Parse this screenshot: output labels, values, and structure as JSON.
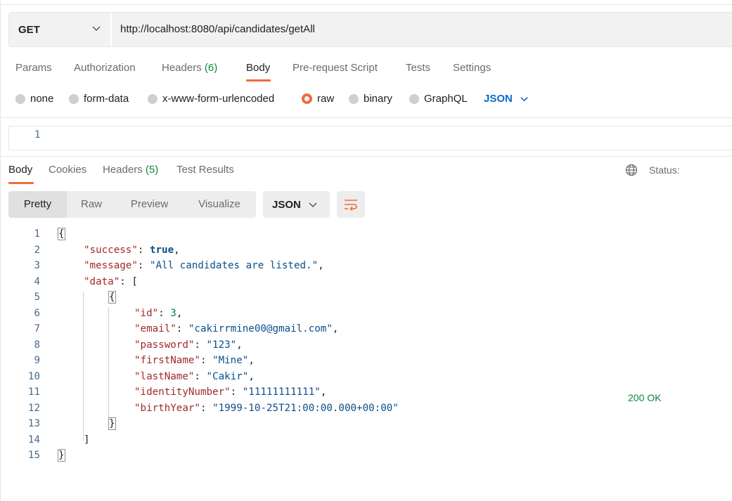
{
  "request": {
    "method": "GET",
    "url": "http://localhost:8080/api/candidates/getAll"
  },
  "request_tabs": [
    {
      "label": "Params"
    },
    {
      "label": "Authorization"
    },
    {
      "label": "Headers",
      "count": "(6)"
    },
    {
      "label": "Body",
      "active": true
    },
    {
      "label": "Pre-request Script"
    },
    {
      "label": "Tests"
    },
    {
      "label": "Settings"
    }
  ],
  "body_types": [
    {
      "label": "none"
    },
    {
      "label": "form-data"
    },
    {
      "label": "x-www-form-urlencoded"
    },
    {
      "label": "raw",
      "selected": true
    },
    {
      "label": "binary"
    },
    {
      "label": "GraphQL"
    }
  ],
  "body_format": "JSON",
  "request_editor": {
    "line_number": "1"
  },
  "response_tabs": [
    {
      "label": "Body",
      "active": true
    },
    {
      "label": "Cookies"
    },
    {
      "label": "Headers",
      "count": "(5)"
    },
    {
      "label": "Test Results"
    }
  ],
  "status": {
    "label": "Status:",
    "code": "200 OK"
  },
  "view_modes": [
    {
      "label": "Pretty",
      "active": true
    },
    {
      "label": "Raw"
    },
    {
      "label": "Preview"
    },
    {
      "label": "Visualize"
    }
  ],
  "response_format": "JSON",
  "response_lines": [
    {
      "n": "1",
      "indent": 0,
      "tokens": [
        {
          "t": "{",
          "c": "p",
          "box": true
        }
      ]
    },
    {
      "n": "2",
      "indent": 1,
      "tokens": [
        {
          "t": "\"success\"",
          "c": "k"
        },
        {
          "t": ": ",
          "c": "p"
        },
        {
          "t": "true",
          "c": "b"
        },
        {
          "t": ",",
          "c": "p"
        }
      ]
    },
    {
      "n": "3",
      "indent": 1,
      "tokens": [
        {
          "t": "\"message\"",
          "c": "k"
        },
        {
          "t": ": ",
          "c": "p"
        },
        {
          "t": "\"All candidates are listed.\"",
          "c": "s"
        },
        {
          "t": ",",
          "c": "p"
        }
      ]
    },
    {
      "n": "4",
      "indent": 1,
      "tokens": [
        {
          "t": "\"data\"",
          "c": "k"
        },
        {
          "t": ": [",
          "c": "p"
        }
      ]
    },
    {
      "n": "5",
      "indent": 2,
      "tokens": [
        {
          "t": "{",
          "c": "p",
          "box": true
        }
      ]
    },
    {
      "n": "6",
      "indent": 3,
      "tokens": [
        {
          "t": "\"id\"",
          "c": "k"
        },
        {
          "t": ": ",
          "c": "p"
        },
        {
          "t": "3",
          "c": "n"
        },
        {
          "t": ",",
          "c": "p"
        }
      ]
    },
    {
      "n": "7",
      "indent": 3,
      "tokens": [
        {
          "t": "\"email\"",
          "c": "k"
        },
        {
          "t": ": ",
          "c": "p"
        },
        {
          "t": "\"cakirrmine00@gmail.com\"",
          "c": "s"
        },
        {
          "t": ",",
          "c": "p"
        }
      ]
    },
    {
      "n": "8",
      "indent": 3,
      "tokens": [
        {
          "t": "\"password\"",
          "c": "k"
        },
        {
          "t": ": ",
          "c": "p"
        },
        {
          "t": "\"123\"",
          "c": "s"
        },
        {
          "t": ",",
          "c": "p"
        }
      ]
    },
    {
      "n": "9",
      "indent": 3,
      "tokens": [
        {
          "t": "\"firstName\"",
          "c": "k"
        },
        {
          "t": ": ",
          "c": "p"
        },
        {
          "t": "\"Mine\"",
          "c": "s"
        },
        {
          "t": ",",
          "c": "p"
        }
      ]
    },
    {
      "n": "10",
      "indent": 3,
      "tokens": [
        {
          "t": "\"lastName\"",
          "c": "k"
        },
        {
          "t": ": ",
          "c": "p"
        },
        {
          "t": "\"Cakir\"",
          "c": "s"
        },
        {
          "t": ",",
          "c": "p"
        }
      ]
    },
    {
      "n": "11",
      "indent": 3,
      "tokens": [
        {
          "t": "\"identityNumber\"",
          "c": "k"
        },
        {
          "t": ": ",
          "c": "p"
        },
        {
          "t": "\"11111111111\"",
          "c": "s"
        },
        {
          "t": ",",
          "c": "p"
        }
      ]
    },
    {
      "n": "12",
      "indent": 3,
      "tokens": [
        {
          "t": "\"birthYear\"",
          "c": "k"
        },
        {
          "t": ": ",
          "c": "p"
        },
        {
          "t": "\"1999-10-25T21:00:00.000+00:00\"",
          "c": "s"
        }
      ]
    },
    {
      "n": "13",
      "indent": 2,
      "tokens": [
        {
          "t": "}",
          "c": "p",
          "box": true
        }
      ]
    },
    {
      "n": "14",
      "indent": 1,
      "tokens": [
        {
          "t": "]",
          "c": "p"
        }
      ]
    },
    {
      "n": "15",
      "indent": 0,
      "tokens": [
        {
          "t": "}",
          "c": "p",
          "box": true
        }
      ]
    }
  ],
  "colors": {
    "accent": "#f26b3a",
    "status_ok": "#0a8a3a",
    "link_blue": "#0b6bcb",
    "json_key": "#a02a2a",
    "json_string": "#0b4f8a"
  },
  "icons": {
    "method_dropdown": "chevron-down-icon",
    "format_dropdown": "chevron-down-icon",
    "wrap": "text-wrap-icon",
    "network": "globe-icon"
  }
}
